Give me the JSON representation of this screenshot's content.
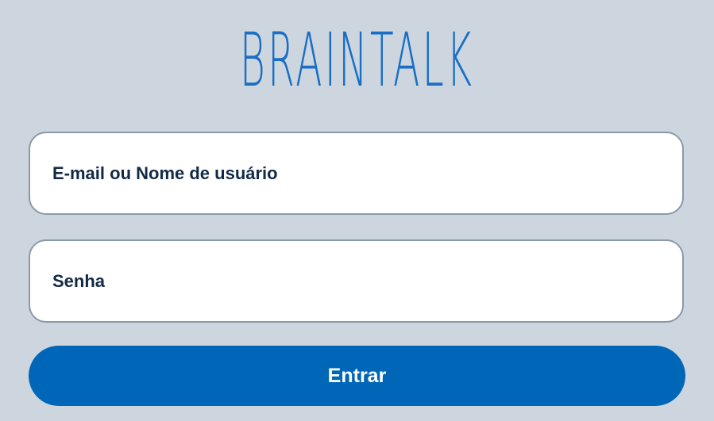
{
  "brand": {
    "logo_text": "BRAINTALK",
    "color": "#1a6fc4"
  },
  "login_form": {
    "username": {
      "placeholder": "E-mail ou Nome de usuário",
      "value": ""
    },
    "password": {
      "placeholder": "Senha",
      "value": ""
    },
    "submit_label": "Entrar"
  },
  "colors": {
    "background": "#cdd6df",
    "button": "#0067b8",
    "field_border": "#8a99aa",
    "text": "#132a46"
  }
}
